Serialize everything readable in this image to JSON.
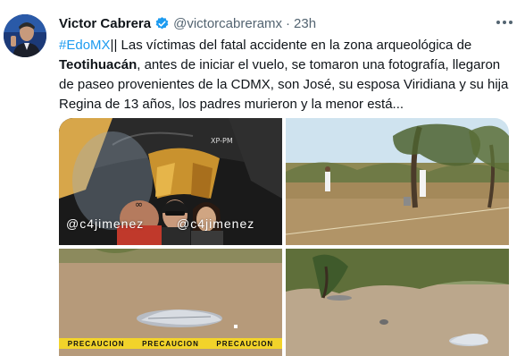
{
  "tweet": {
    "author_name": "Victor Cabrera",
    "handle": "@victorcabreramx",
    "separator": "·",
    "time": "23h",
    "hashtag": "#EdoMX",
    "text_part1": "|| Las víctimas del fatal accidente en la zona arqueológica de ",
    "bold_place": "Teotihuacán",
    "text_part2": ", antes de iniciar el vuelo, se tomaron una fotografía, llegaron de paseo provenientes de la CDMX, son José, su esposa Viridiana y su hija Regina de 13  años, los padres murieron y la menor está..."
  },
  "media": {
    "watermark1": "@c4jimenez",
    "watermark2": "@c4jimenez",
    "caution_text": "PRECAUCION"
  },
  "colors": {
    "text": "#0f1419",
    "secondary": "#536471",
    "link": "#1d9bf0",
    "verified": "#1d9bf0"
  }
}
